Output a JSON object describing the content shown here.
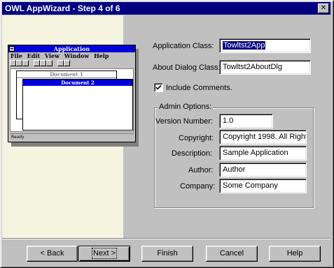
{
  "window": {
    "title": "OWL AppWizard - Step 4 of 6",
    "close_glyph": "✕"
  },
  "illustration": {
    "app_title": "Application",
    "menu": [
      "File",
      "Edit",
      "View",
      "Window",
      "Help"
    ],
    "doc1_title": "Document 1",
    "doc2_title": "Document 2",
    "status": "Ready"
  },
  "form": {
    "app_class_label": "Application Class:",
    "app_class_value": "Towltst2App",
    "about_class_label": "About Dialog Class:",
    "about_class_value": "Towltst2AboutDlg",
    "include_comments_label": "Include Comments.",
    "include_comments_checked": true
  },
  "admin": {
    "group_title": "Admin Options:",
    "version_label": "Version Number:",
    "version_value": "1.0",
    "copyright_label": "Copyright:",
    "copyright_value": "Copyright 1998. All Right",
    "description_label": "Description:",
    "description_value": "Sample Application",
    "author_label": "Author:",
    "author_value": "Author",
    "company_label": "Company:",
    "company_value": "Some Company"
  },
  "buttons": {
    "back": "< Back",
    "next": "Next >",
    "finish": "Finish",
    "cancel": "Cancel",
    "help": "Help"
  },
  "colors": {
    "titlebar": "#000080",
    "face": "#c0c0c0",
    "panel": "#fffff0"
  }
}
